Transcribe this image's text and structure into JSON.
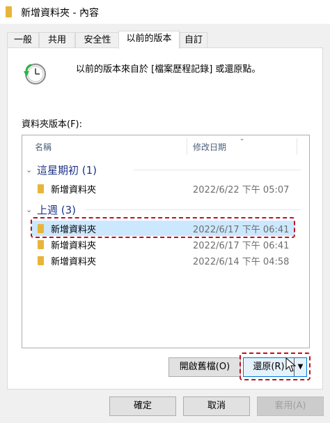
{
  "window": {
    "title": "新增資料夾 - 內容"
  },
  "tabs": [
    {
      "label": "一般"
    },
    {
      "label": "共用"
    },
    {
      "label": "安全性"
    },
    {
      "label": "以前的版本"
    },
    {
      "label": "自訂"
    }
  ],
  "active_tab": "以前的版本",
  "panel": {
    "info_text": "以前的版本來自於 [檔案歷程記錄] 或還原點。",
    "list_label": "資料夾版本(F):",
    "columns": {
      "name": "名稱",
      "date": "修改日期"
    },
    "groups": [
      {
        "title": "這星期初 (1)",
        "items": [
          {
            "name": "新增資料夾",
            "date": "2022/6/22 下午 05:07"
          }
        ]
      },
      {
        "title": "上週 (3)",
        "items": [
          {
            "name": "新增資料夾",
            "date": "2022/6/17 下午 06:41"
          },
          {
            "name": "新增資料夾",
            "date": "2022/6/17 下午 06:41"
          },
          {
            "name": "新增資料夾",
            "date": "2022/6/14 下午 04:58"
          }
        ]
      }
    ],
    "open_button": "開啟舊檔(O)",
    "restore_button": "還原(R)"
  },
  "footer": {
    "ok": "確定",
    "cancel": "取消",
    "apply": "套用(A)"
  },
  "colors": {
    "selection": "#cce8ff",
    "group_header": "#1e3287",
    "highlight": "#c0101f",
    "folder": "#e8b53a"
  }
}
